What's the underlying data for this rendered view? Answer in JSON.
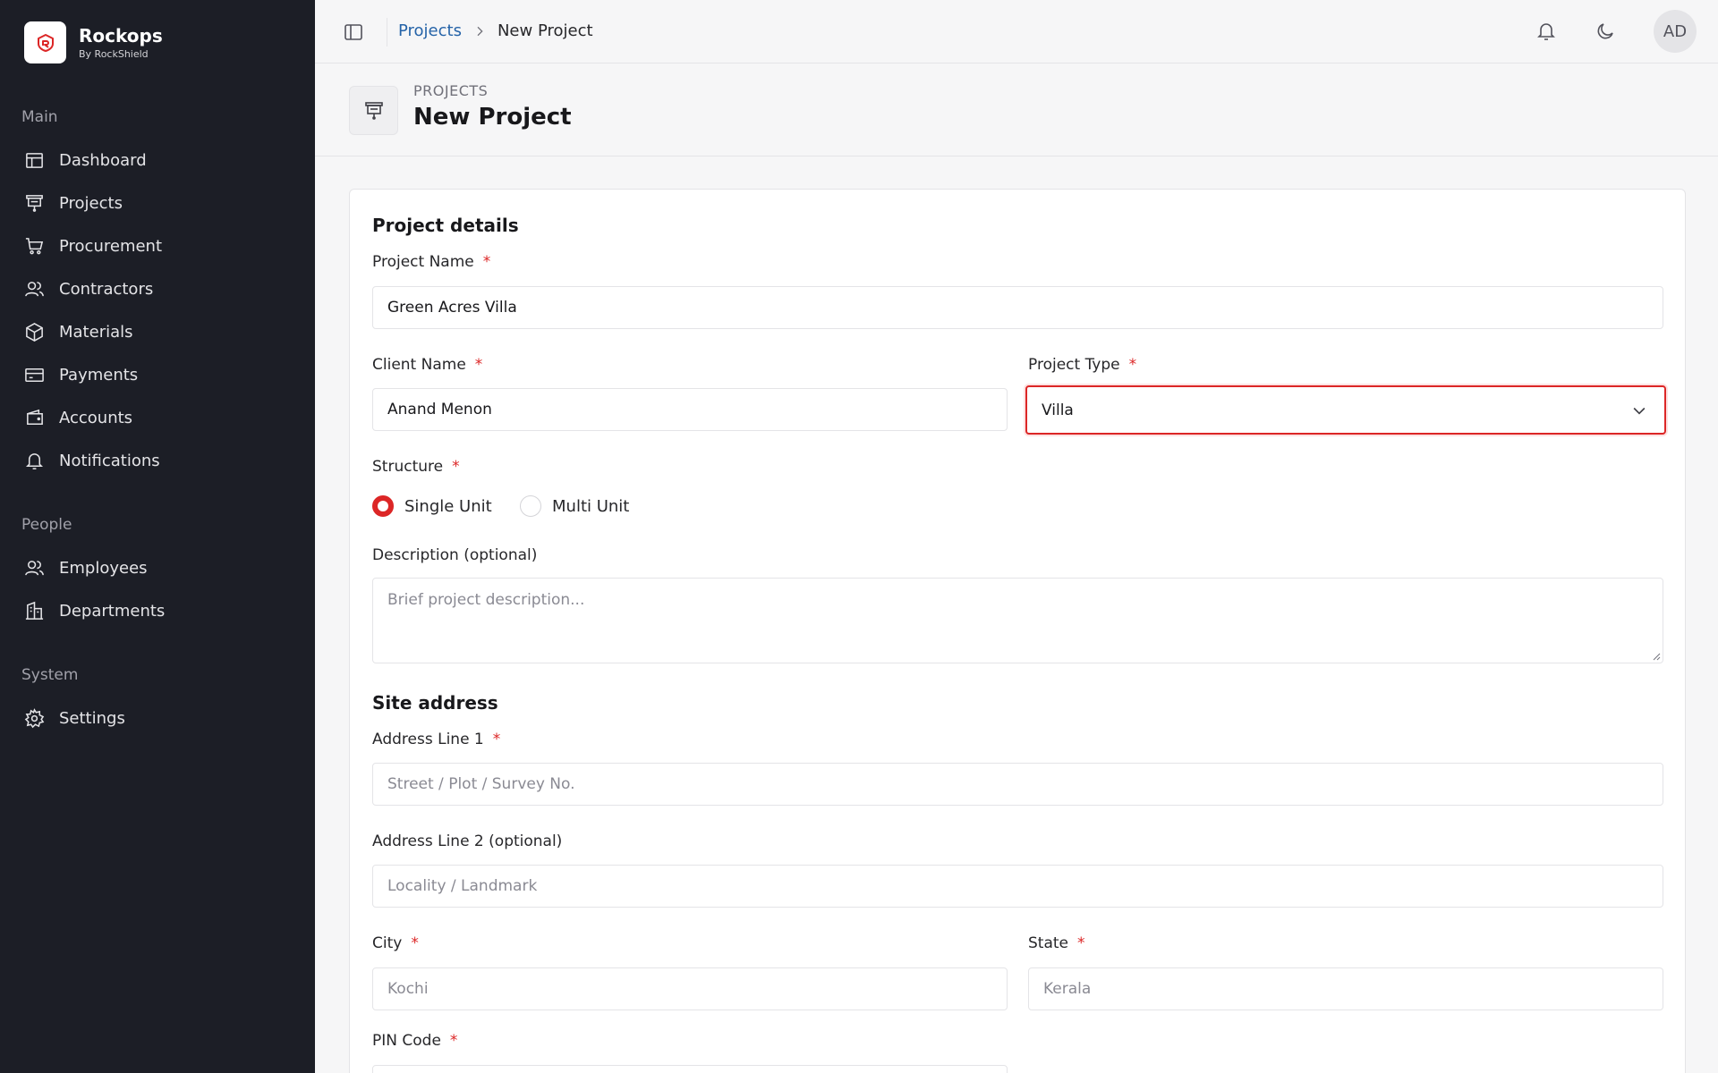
{
  "brand": {
    "name": "Rockops",
    "subtitle": "By RockShield"
  },
  "sidebar": {
    "sections": [
      {
        "heading": "Main",
        "items": [
          {
            "label": "Dashboard",
            "icon": "dashboard-icon"
          },
          {
            "label": "Projects",
            "icon": "projects-icon"
          },
          {
            "label": "Procurement",
            "icon": "cart-icon"
          },
          {
            "label": "Contractors",
            "icon": "users-icon"
          },
          {
            "label": "Materials",
            "icon": "box-icon"
          },
          {
            "label": "Payments",
            "icon": "card-icon"
          },
          {
            "label": "Accounts",
            "icon": "wallet-icon"
          },
          {
            "label": "Notifications",
            "icon": "bell-icon"
          }
        ]
      },
      {
        "heading": "People",
        "items": [
          {
            "label": "Employees",
            "icon": "users-icon"
          },
          {
            "label": "Departments",
            "icon": "building-icon"
          }
        ]
      },
      {
        "heading": "System",
        "items": [
          {
            "label": "Settings",
            "icon": "gear-icon"
          }
        ]
      }
    ]
  },
  "topbar": {
    "breadcrumb": {
      "parent": "Projects",
      "current": "New Project"
    },
    "avatar_initials": "AD"
  },
  "page_header": {
    "kicker": "PROJECTS",
    "title": "New Project"
  },
  "form": {
    "project_details_title": "Project details",
    "project_name": {
      "label": "Project Name",
      "value": "Green Acres Villa"
    },
    "client_name": {
      "label": "Client Name",
      "value": "Anand Menon"
    },
    "project_type": {
      "label": "Project Type",
      "value": "Villa"
    },
    "structure": {
      "label": "Structure",
      "options": [
        "Single Unit",
        "Multi Unit"
      ],
      "selected": "Single Unit"
    },
    "description": {
      "label": "Description (optional)",
      "placeholder": "Brief project description..."
    },
    "site_address_title": "Site address",
    "address_line1": {
      "label": "Address Line 1",
      "placeholder": "Street / Plot / Survey No."
    },
    "address_line2": {
      "label": "Address Line 2 (optional)",
      "placeholder": "Locality / Landmark"
    },
    "city": {
      "label": "City",
      "placeholder": "Kochi"
    },
    "state": {
      "label": "State",
      "placeholder": "Kerala"
    },
    "pin_code": {
      "label": "PIN Code"
    },
    "required_marker": "*"
  },
  "colors": {
    "accent": "#dc2626",
    "sidebar_bg": "#1c1e26",
    "link": "#2563a8"
  }
}
